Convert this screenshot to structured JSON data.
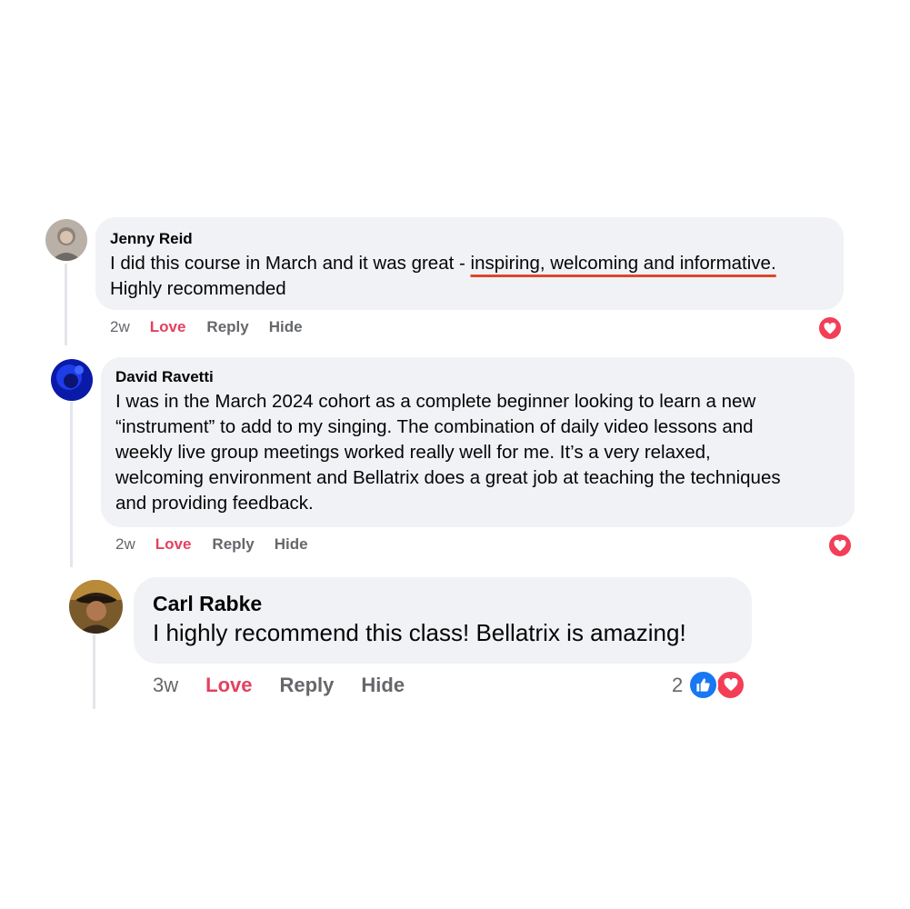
{
  "comments": [
    {
      "author": "Jenny Reid",
      "text_line1_plain": "I did this course in March and it was great - ",
      "text_line1_highlight": "inspiring, welcoming and informative.",
      "text_line2": "Highly recommended",
      "time": "2w",
      "actions": {
        "love": "Love",
        "reply": "Reply",
        "hide": "Hide"
      },
      "reactions": [
        "heart-icon"
      ]
    },
    {
      "author": "David Ravetti",
      "text_lines": [
        "I was in the March 2024 cohort as a complete beginner looking to learn a new",
        "“instrument” to add to my singing. The combination of daily video lessons and",
        "weekly live group meetings worked really well for me. It’s a very relaxed,",
        "welcoming environment and Bellatrix does a great job at teaching the techniques",
        "and providing feedback."
      ],
      "time": "2w",
      "actions": {
        "love": "Love",
        "reply": "Reply",
        "hide": "Hide"
      },
      "reactions": [
        "heart-icon"
      ]
    },
    {
      "author": "Carl Rabke",
      "text": "I highly recommend this class! Bellatrix is amazing!",
      "time": "3w",
      "actions": {
        "love": "Love",
        "reply": "Reply",
        "hide": "Hide"
      },
      "reaction_count": "2",
      "reactions": [
        "like-icon",
        "heart-icon"
      ]
    }
  ],
  "colors": {
    "bubble": "#f0f2f5",
    "love": "#e4405f",
    "meta": "#65676b",
    "underline": "#e0452b",
    "heart": "#f33e58",
    "like": "#1877f2"
  }
}
